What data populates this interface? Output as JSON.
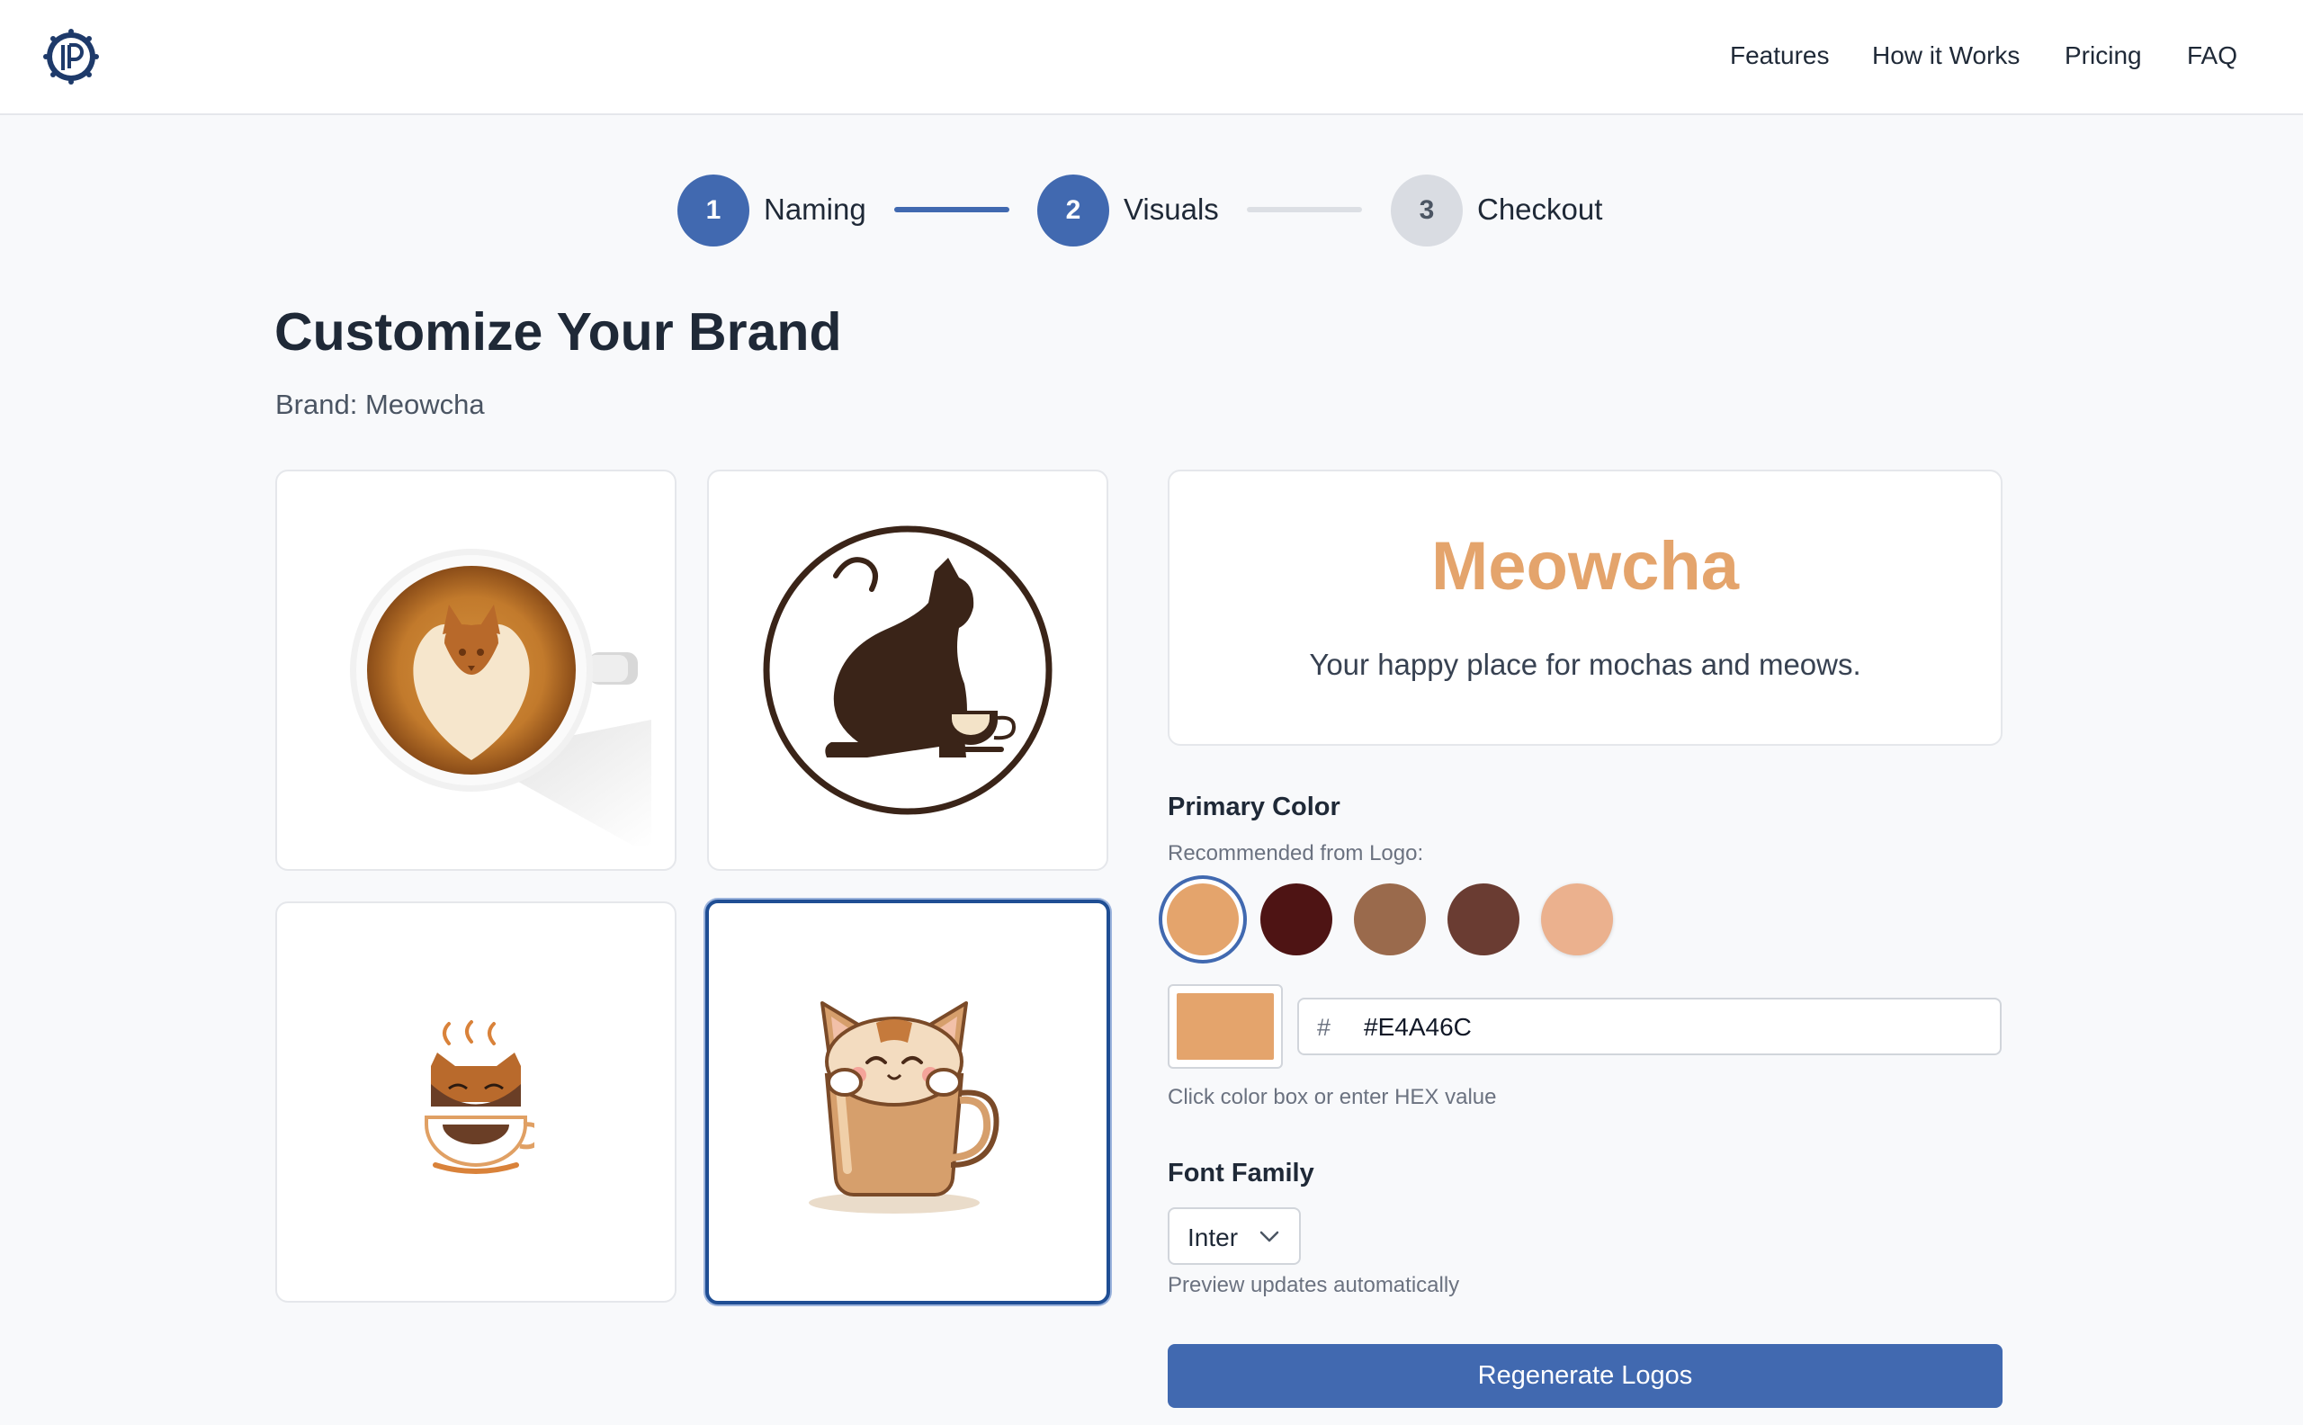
{
  "header": {
    "logo_letter": "P",
    "nav": [
      "Features",
      "How it Works",
      "Pricing",
      "FAQ"
    ]
  },
  "steps": [
    {
      "number": "1",
      "label": "Naming",
      "state": "completed"
    },
    {
      "number": "2",
      "label": "Visuals",
      "state": "active"
    },
    {
      "number": "3",
      "label": "Checkout",
      "state": "pending"
    }
  ],
  "page": {
    "title": "Customize Your Brand",
    "brand_line": "Brand: Meowcha"
  },
  "logo_options": [
    {
      "icon": "latte-art-cat-icon",
      "selected": false
    },
    {
      "icon": "cat-silhouette-cup-icon",
      "selected": false
    },
    {
      "icon": "cat-steaming-cup-icon",
      "selected": false
    },
    {
      "icon": "kitten-in-mug-icon",
      "selected": true
    }
  ],
  "preview": {
    "brand_name": "Meowcha",
    "tagline": "Your happy place for mochas and meows."
  },
  "primary_color": {
    "label": "Primary Color",
    "recommended_label": "Recommended from Logo:",
    "swatches": [
      "#E4A46C",
      "#4E1414",
      "#9A6A4C",
      "#6A3C32",
      "#EBB18E"
    ],
    "selected_index": 0,
    "hash_symbol": "#",
    "hex_value": "#E4A46C",
    "hint": "Click color box or enter HEX value"
  },
  "font_family": {
    "label": "Font Family",
    "value": "Inter",
    "hint": "Preview updates automatically"
  },
  "actions": {
    "regenerate_label": "Regenerate Logos"
  },
  "colors": {
    "accent": "#4169b0",
    "selected_border": "#1f4e94"
  }
}
